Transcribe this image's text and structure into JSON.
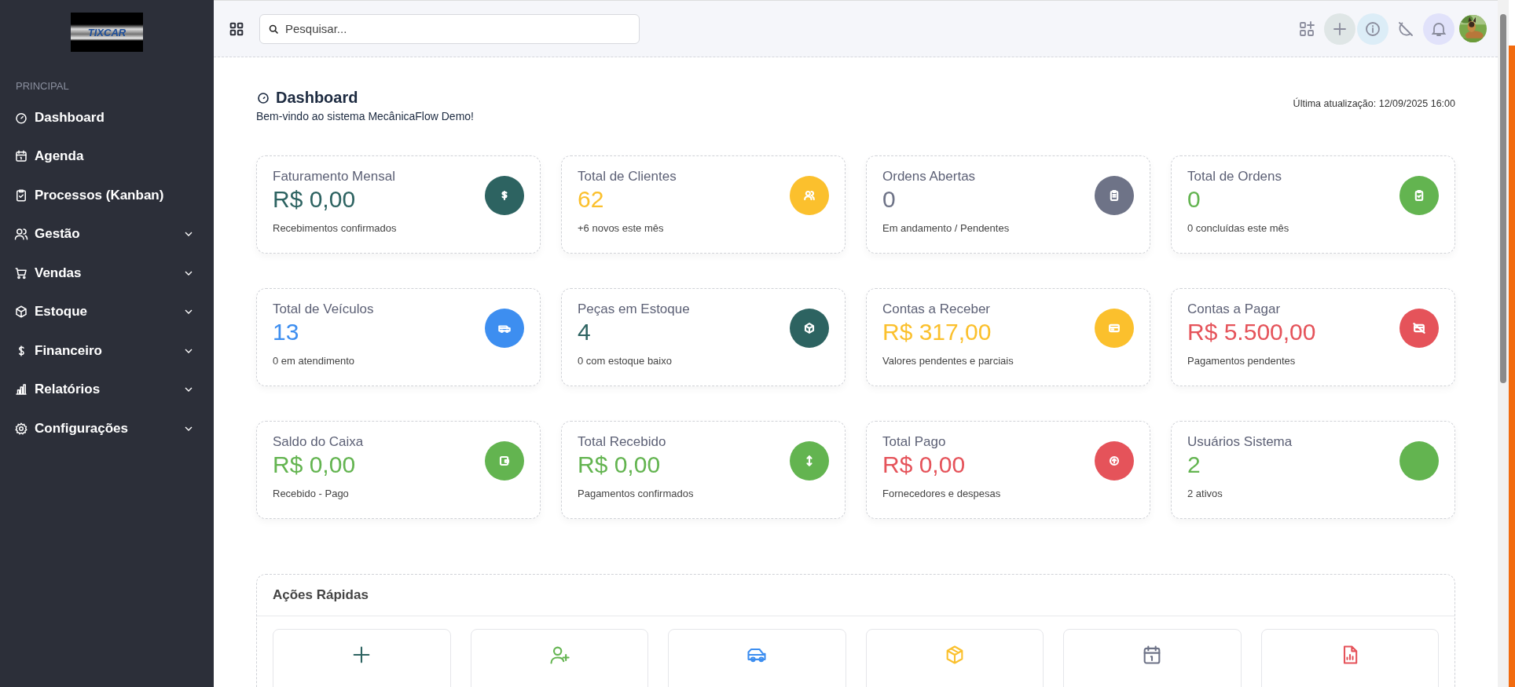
{
  "sidebar": {
    "logo": "TIXCAR",
    "section": "PRINCIPAL",
    "items": [
      {
        "label": "Dashboard",
        "kind": "link"
      },
      {
        "label": "Agenda",
        "kind": "link"
      },
      {
        "label": "Processos (Kanban)",
        "kind": "link"
      },
      {
        "label": "Gestão",
        "kind": "group",
        "expanded": false
      },
      {
        "label": "Vendas",
        "kind": "group",
        "expanded": false
      },
      {
        "label": "Estoque",
        "kind": "group",
        "expanded": false
      },
      {
        "label": "Financeiro",
        "kind": "group",
        "expanded": false
      },
      {
        "label": "Relatórios",
        "kind": "group",
        "expanded": false
      },
      {
        "label": "Configurações",
        "kind": "group",
        "expanded": false
      }
    ]
  },
  "topbar": {
    "search": {
      "placeholder": "Pesquisar..."
    }
  },
  "header": {
    "title": "Dashboard",
    "subtitle": "Bem-vindo ao sistema MecânicaFlow Demo!",
    "updated": "Última atualização: 12/09/2025 16:00"
  },
  "cards": [
    {
      "title": "Faturamento Mensal",
      "value": "R$ 0,00",
      "note": "Recebimentos confirmados",
      "color": "#2d6361"
    },
    {
      "title": "Total de Clientes",
      "value": "62",
      "note": "+6 novos este mês",
      "color": "#fbc02d"
    },
    {
      "title": "Ordens Abertas",
      "value": "0",
      "note": "Em andamento / Pendentes",
      "color": "#6e7387"
    },
    {
      "title": "Total de Ordens",
      "value": "0",
      "note": "0 concluídas este mês",
      "color": "#63b450"
    },
    {
      "title": "Total de Veículos",
      "value": "13",
      "note": "0 em atendimento",
      "color": "#3d8ef0"
    },
    {
      "title": "Peças em Estoque",
      "value": "4",
      "note": "0 com estoque baixo",
      "color": "#2d6361"
    },
    {
      "title": "Contas a Receber",
      "value": "R$ 317,00",
      "note": "Valores pendentes e parciais",
      "color": "#fbc02d"
    },
    {
      "title": "Contas a Pagar",
      "value": "R$ 5.500,00",
      "note": "Pagamentos pendentes",
      "color": "#e5535a"
    },
    {
      "title": "Saldo do Caixa",
      "value": "R$ 0,00",
      "note": "Recebido - Pago",
      "color": "#63b450"
    },
    {
      "title": "Total Recebido",
      "value": "R$ 0,00",
      "note": "Pagamentos confirmados",
      "color": "#63b450"
    },
    {
      "title": "Total Pago",
      "value": "R$ 0,00",
      "note": "Fornecedores e despesas",
      "color": "#e5535a"
    },
    {
      "title": "Usuários Sistema",
      "value": "2",
      "note": "2 ativos",
      "color": "#63b450"
    }
  ],
  "quick_actions": {
    "title": "Ações Rápidas",
    "items": [
      {
        "color": "#2d6361"
      },
      {
        "color": "#63b450"
      },
      {
        "color": "#3d8ef0"
      },
      {
        "color": "#fbc02d"
      },
      {
        "color": "#6e7387"
      },
      {
        "color": "#e5535a"
      }
    ]
  }
}
